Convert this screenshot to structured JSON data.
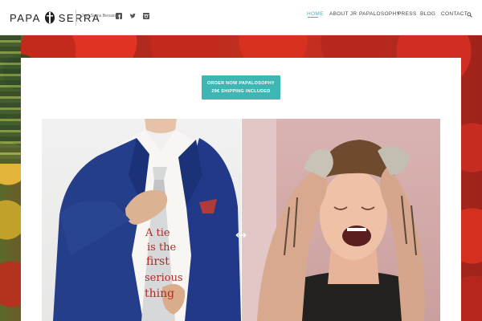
{
  "brand": {
    "logo_left": "PAPA",
    "logo_right": "SERRA",
    "tagline": "Joel Serra Bessin"
  },
  "social": [
    "facebook-icon",
    "twitter-icon",
    "instagram-icon"
  ],
  "nav": {
    "items": [
      {
        "label": "HOME",
        "active": true
      },
      {
        "label": "ABOUT JR",
        "active": false
      },
      {
        "label": "PAPALOSOPHY",
        "active": false
      },
      {
        "label": "PRESS",
        "active": false
      },
      {
        "label": "BLOG",
        "active": false
      },
      {
        "label": "CONTACT",
        "active": false
      }
    ],
    "search_icon": "search-icon"
  },
  "cta": {
    "line1": "ORDER NOW PAPALOSOPHY",
    "line2": "29€ SHIPPING INCLUDED"
  },
  "comparison": {
    "split_fraction": 0.5,
    "tie_text": "A tie is the first serious thing"
  },
  "colors": {
    "accent": "#3fb6b8",
    "cta_bg": "#3db6b4",
    "jacket": "#243e8a",
    "tomato": "#c93022"
  }
}
